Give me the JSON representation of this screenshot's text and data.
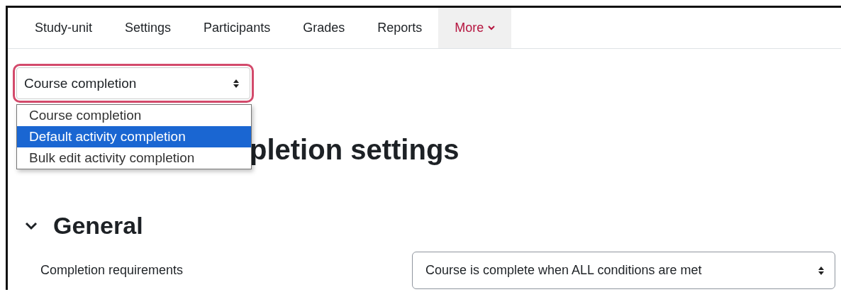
{
  "tabs": [
    {
      "label": "Study-unit",
      "selected": false,
      "kind": "link"
    },
    {
      "label": "Settings",
      "selected": false,
      "kind": "link"
    },
    {
      "label": "Participants",
      "selected": false,
      "kind": "link"
    },
    {
      "label": "Grades",
      "selected": false,
      "kind": "link"
    },
    {
      "label": "Reports",
      "selected": false,
      "kind": "link"
    },
    {
      "label": "More",
      "selected": true,
      "kind": "menu"
    }
  ],
  "page_select": {
    "value": "Course completion",
    "highlighted": true,
    "options": [
      {
        "label": "Course completion",
        "highlighted": false
      },
      {
        "label": "Default activity completion",
        "highlighted": true
      },
      {
        "label": "Bulk edit activity completion",
        "highlighted": false
      }
    ]
  },
  "heading": "pletion settings",
  "section": {
    "title": "General",
    "expanded": true
  },
  "fields": [
    {
      "label": "Completion requirements",
      "value": "Course is complete when ALL conditions are met"
    }
  ]
}
